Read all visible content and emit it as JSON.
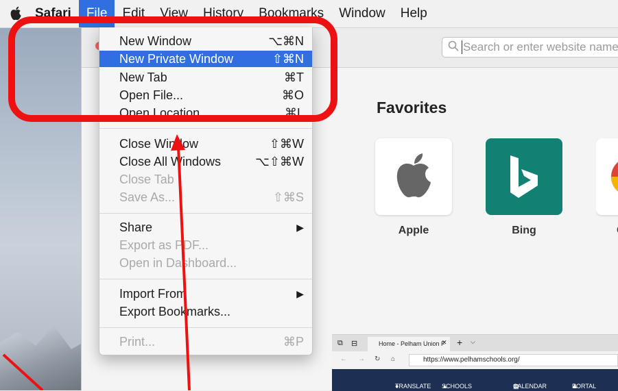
{
  "menubar": {
    "items": [
      {
        "label": "Safari"
      },
      {
        "label": "File"
      },
      {
        "label": "Edit"
      },
      {
        "label": "View"
      },
      {
        "label": "History"
      },
      {
        "label": "Bookmarks"
      },
      {
        "label": "Window"
      },
      {
        "label": "Help"
      }
    ]
  },
  "file_menu": {
    "items": [
      {
        "label": "New Window",
        "shortcut": "⌥⌘N"
      },
      {
        "label": "New Private Window",
        "shortcut": "⇧⌘N"
      },
      {
        "label": "New Tab",
        "shortcut": "⌘T"
      },
      {
        "label": "Open File...",
        "shortcut": "⌘O"
      },
      {
        "label": "Open Location...",
        "shortcut": "⌘L"
      },
      {
        "label": "Close Window",
        "shortcut": "⇧⌘W"
      },
      {
        "label": "Close All Windows",
        "shortcut": "⌥⇧⌘W"
      },
      {
        "label": "Close Tab",
        "shortcut": ""
      },
      {
        "label": "Save As...",
        "shortcut": "⇧⌘S"
      },
      {
        "label": "Share",
        "shortcut": "▶"
      },
      {
        "label": "Export as PDF...",
        "shortcut": ""
      },
      {
        "label": "Open in Dashboard...",
        "shortcut": ""
      },
      {
        "label": "Import From",
        "shortcut": "▶"
      },
      {
        "label": "Export Bookmarks...",
        "shortcut": ""
      },
      {
        "label": "Print...",
        "shortcut": "⌘P"
      }
    ]
  },
  "safari": {
    "search_placeholder": "Search or enter website name",
    "favorites_title": "Favorites",
    "favorites": [
      {
        "label": "Apple"
      },
      {
        "label": "Bing"
      },
      {
        "label": "G"
      }
    ]
  },
  "browser2": {
    "tab_title": "Home - Pelham Union F",
    "url": "https://www.pelhamschools.org/",
    "nav": [
      "TRANSLATE",
      "SCHOOLS",
      "CALENDAR",
      "PORTAL"
    ]
  },
  "colors": {
    "highlight": "#2f6fe0",
    "annotation_red": "#ee1111",
    "bing_green": "#138074"
  }
}
